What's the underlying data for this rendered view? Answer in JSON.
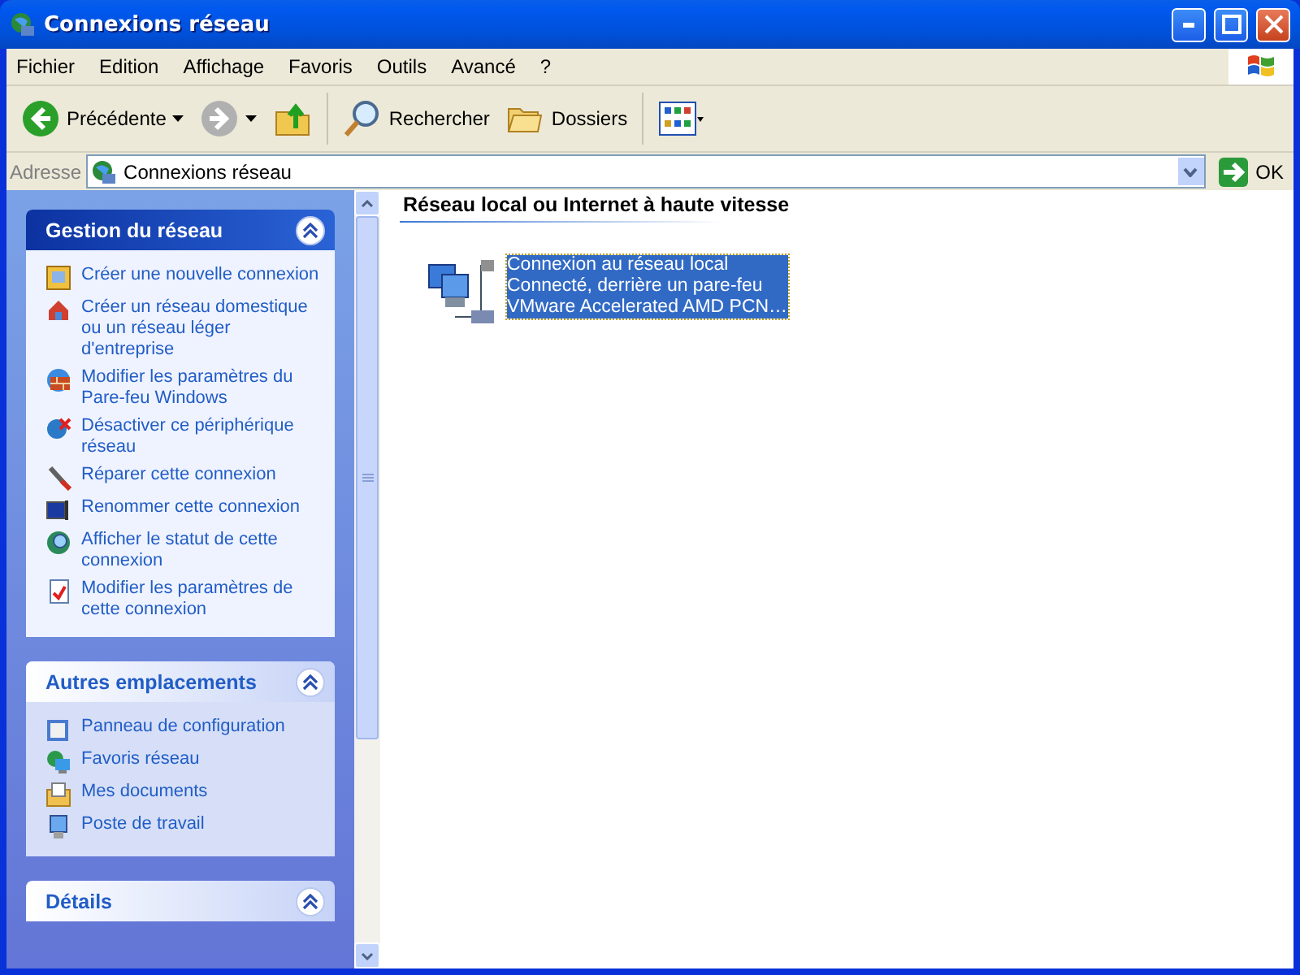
{
  "window": {
    "title": "Connexions réseau"
  },
  "menu": [
    "Fichier",
    "Edition",
    "Affichage",
    "Favoris",
    "Outils",
    "Avancé",
    "?"
  ],
  "toolbar": [
    {
      "kind": "back",
      "label": "Précédente"
    },
    {
      "kind": "forward",
      "disabled": true
    },
    {
      "kind": "up"
    },
    {
      "kind": "search",
      "label": "Rechercher"
    },
    {
      "kind": "folders",
      "label": "Dossiers"
    },
    {
      "kind": "views"
    }
  ],
  "address": {
    "label": "Adresse",
    "value": "Connexions réseau",
    "go": "OK"
  },
  "sidebar": [
    {
      "title": "Gestion du réseau",
      "primary": true,
      "items": [
        "Créer une nouvelle connexion",
        "Créer un réseau domestique ou un réseau léger d'entreprise",
        "Modifier les paramètres du Pare-feu Windows",
        "Désactiver ce périphérique réseau",
        "Réparer cette connexion",
        "Renommer cette connexion",
        "Afficher le statut de cette connexion",
        "Modifier les paramètres de cette connexion"
      ]
    },
    {
      "title": "Autres emplacements",
      "primary": false,
      "items": [
        "Panneau de configuration",
        "Favoris réseau",
        "Mes documents",
        "Poste de travail"
      ]
    },
    {
      "title": "Détails",
      "primary": false
    }
  ],
  "content": {
    "group": "Réseau local ou Internet à haute vitesse",
    "connections": [
      {
        "name": "Connexion au réseau local",
        "status": "Connecté, derrière un pare-feu",
        "device": "VMware Accelerated AMD PCN…",
        "selected": true
      }
    ]
  }
}
